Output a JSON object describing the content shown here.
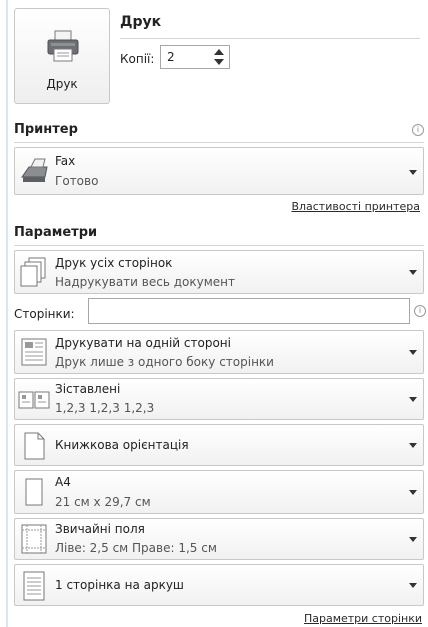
{
  "print": {
    "button_label": "Друк",
    "title": "Друк",
    "copies_label": "Копії:",
    "copies_value": "2"
  },
  "printer": {
    "section_title": "Принтер",
    "name": "Fax",
    "status": "Готово",
    "properties_link": "Властивості принтера"
  },
  "settings": {
    "section_title": "Параметри",
    "pages_label": "Сторінки:",
    "pages_value": "",
    "options": [
      {
        "line1": "Друк усіх сторінок",
        "line2": "Надрукувати весь документ",
        "icon": "pages-icon"
      },
      {
        "line1": "Друкувати на одній стороні",
        "line2": "Друк лише з одного боку сторінки",
        "icon": "one-sided-icon"
      },
      {
        "line1": "Зіставлені",
        "line2": "1,2,3    1,2,3    1,2,3",
        "icon": "collated-icon"
      },
      {
        "line1": "Книжкова орієнтація",
        "line2": "",
        "icon": "portrait-icon"
      },
      {
        "line1": "A4",
        "line2": "21 см x 29,7 см",
        "icon": "paper-size-icon"
      },
      {
        "line1": "Звичайні поля",
        "line2": "Ліве:  2,5 см    Праве:  1,5 см",
        "icon": "margins-icon"
      },
      {
        "line1": "1 сторінка на аркуш",
        "line2": "",
        "icon": "pages-per-sheet-icon"
      }
    ],
    "page_setup_link": "Параметри сторінки"
  }
}
